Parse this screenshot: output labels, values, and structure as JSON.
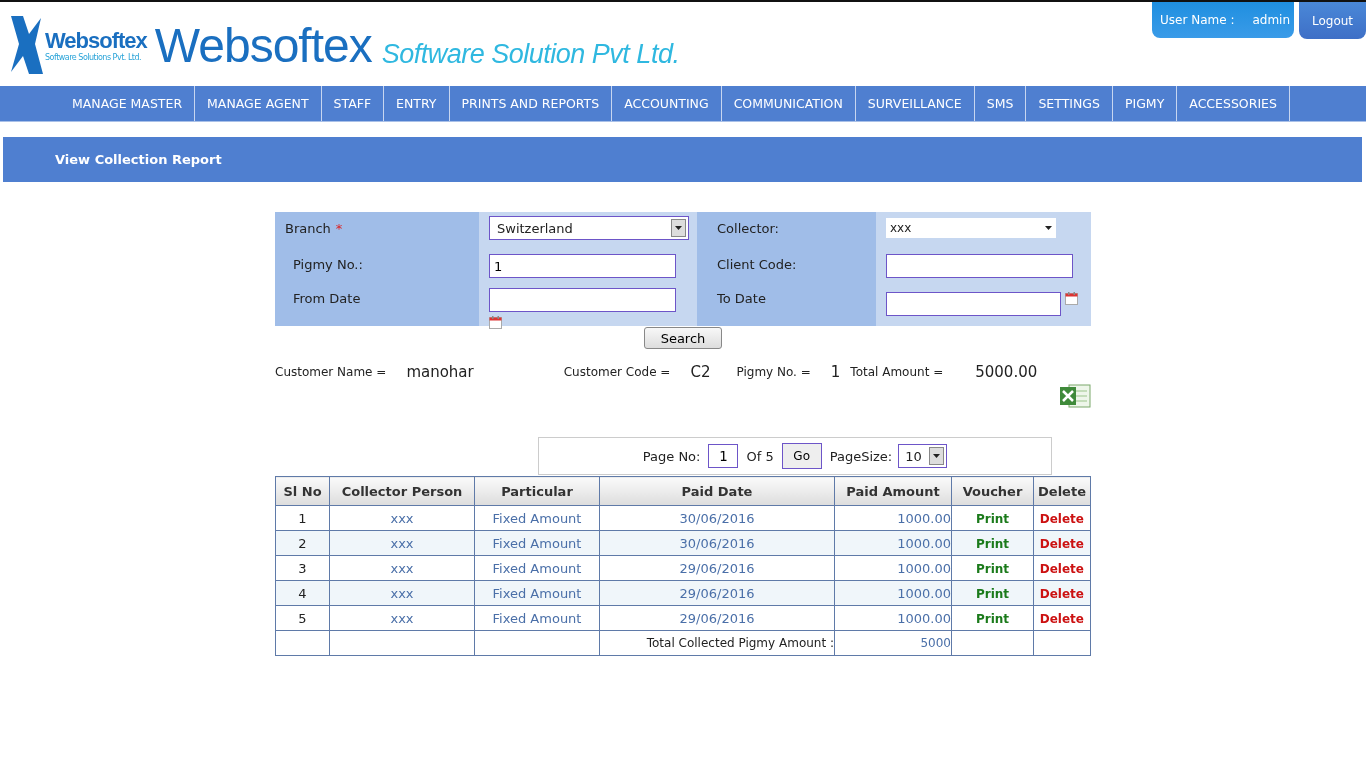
{
  "logo": {
    "mark_title": "Websoftex",
    "mark_subtitle": "Software Solutions Pvt. Ltd.",
    "name": "Websoftex",
    "tagline": "Software Solution Pvt Ltd."
  },
  "user": {
    "label": "User Name :",
    "name": "admin",
    "logout": "Logout"
  },
  "nav": [
    "MANAGE MASTER",
    "MANAGE AGENT",
    "STAFF",
    "ENTRY",
    "PRINTS AND REPORTS",
    "ACCOUNTING",
    "COMMUNICATION",
    "SURVEILLANCE",
    "SMS",
    "SETTINGS",
    "PIGMY",
    "ACCESSORIES"
  ],
  "page_title": "View Collection Report",
  "form": [
    {
      "label": "Branch",
      "required_mark": "*",
      "kind": "select",
      "value": "Switzerland"
    },
    {
      "label": "Collector:",
      "kind": "dropdown",
      "value": "xxx"
    },
    {
      "label": "Pigmy No.:",
      "kind": "text",
      "value": "1"
    },
    {
      "label": "Client Code:",
      "kind": "text"
    },
    {
      "label": "From Date",
      "kind": "date"
    },
    {
      "label": "To Date",
      "kind": "date"
    }
  ],
  "search_button": "Search",
  "summary": [
    {
      "label": "Customer Name =",
      "value": "manohar"
    },
    {
      "label": "Customer Code =",
      "value": "C2"
    },
    {
      "label": "Pigmy No. =",
      "value": "1"
    },
    {
      "label": "Total Amount =",
      "value": "5000.00"
    }
  ],
  "pager": {
    "page_label": "Page No:",
    "page": "1",
    "of": "Of 5",
    "go": "Go",
    "size_label": "PageSize:",
    "size": "10"
  },
  "table": {
    "columns": [
      "Sl No",
      "Collector Person",
      "Particular",
      "Paid Date",
      "Paid Amount",
      "Voucher",
      "Delete"
    ],
    "rows": [
      {
        "sl": "1",
        "collector": "xxx",
        "particular": "Fixed Amount",
        "date": "30/06/2016",
        "amount": "1000.00",
        "voucher": "Print",
        "delete": "Delete"
      },
      {
        "sl": "2",
        "collector": "xxx",
        "particular": "Fixed Amount",
        "date": "30/06/2016",
        "amount": "1000.00",
        "voucher": "Print",
        "delete": "Delete"
      },
      {
        "sl": "3",
        "collector": "xxx",
        "particular": "Fixed Amount",
        "date": "29/06/2016",
        "amount": "1000.00",
        "voucher": "Print",
        "delete": "Delete"
      },
      {
        "sl": "4",
        "collector": "xxx",
        "particular": "Fixed Amount",
        "date": "29/06/2016",
        "amount": "1000.00",
        "voucher": "Print",
        "delete": "Delete"
      },
      {
        "sl": "5",
        "collector": "xxx",
        "particular": "Fixed Amount",
        "date": "29/06/2016",
        "amount": "1000.00",
        "voucher": "Print",
        "delete": "Delete"
      }
    ],
    "total_label": "Total Collected Pigmy Amount :",
    "total": "5000"
  }
}
